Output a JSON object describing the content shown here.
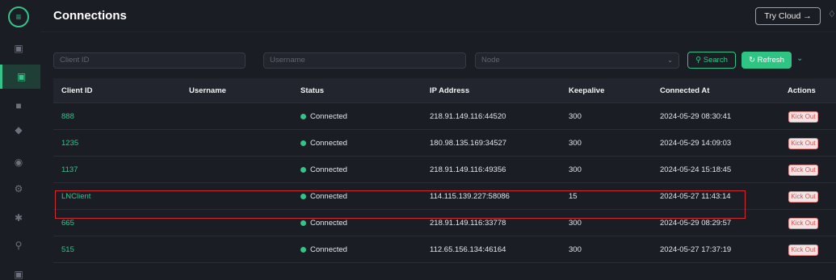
{
  "header": {
    "title": "Connections",
    "try_cloud": "Try Cloud →"
  },
  "filters": {
    "client_id_placeholder": "Client ID",
    "username_placeholder": "Username",
    "node_placeholder": "Node",
    "search_label": "Search",
    "refresh_label": "Refresh"
  },
  "table": {
    "columns": [
      "Client ID",
      "Username",
      "Status",
      "IP Address",
      "Keepalive",
      "Connected At",
      "Actions"
    ],
    "rows": [
      {
        "client_id": "888",
        "username": "",
        "status": "Connected",
        "ip": "218.91.149.116:44520",
        "keepalive": "300",
        "connected_at": "2024-05-29 08:30:41",
        "action": "Kick Out"
      },
      {
        "client_id": "1235",
        "username": "",
        "status": "Connected",
        "ip": "180.98.135.169:34527",
        "keepalive": "300",
        "connected_at": "2024-05-29 14:09:03",
        "action": "Kick Out"
      },
      {
        "client_id": "1137",
        "username": "",
        "status": "Connected",
        "ip": "218.91.149.116:49356",
        "keepalive": "300",
        "connected_at": "2024-05-24 15:18:45",
        "action": "Kick Out"
      },
      {
        "client_id": "LNClient",
        "username": "",
        "status": "Connected",
        "ip": "114.115.139.227:58086",
        "keepalive": "15",
        "connected_at": "2024-05-27 11:43:14",
        "action": "Kick Out"
      },
      {
        "client_id": "665",
        "username": "",
        "status": "Connected",
        "ip": "218.91.149.116:33778",
        "keepalive": "300",
        "connected_at": "2024-05-29 08:29:57",
        "action": "Kick Out"
      },
      {
        "client_id": "515",
        "username": "",
        "status": "Connected",
        "ip": "112.65.156.134:46164",
        "keepalive": "300",
        "connected_at": "2024-05-27 17:37:19",
        "action": "Kick Out"
      }
    ]
  },
  "colors": {
    "accent": "#34c388",
    "background": "#1b1d24",
    "highlight_border": "#d02b32",
    "kick_text": "#d9534f"
  },
  "icons": [
    "logo-icon",
    "dashboard-icon",
    "connections-icon",
    "topics-icon",
    "security-icon",
    "cluster-icon",
    "settings-icon",
    "extensions-icon",
    "diagnose-icon",
    "storage-icon",
    "bell-icon",
    "search-icon",
    "refresh-icon",
    "chevron-down-icon"
  ]
}
